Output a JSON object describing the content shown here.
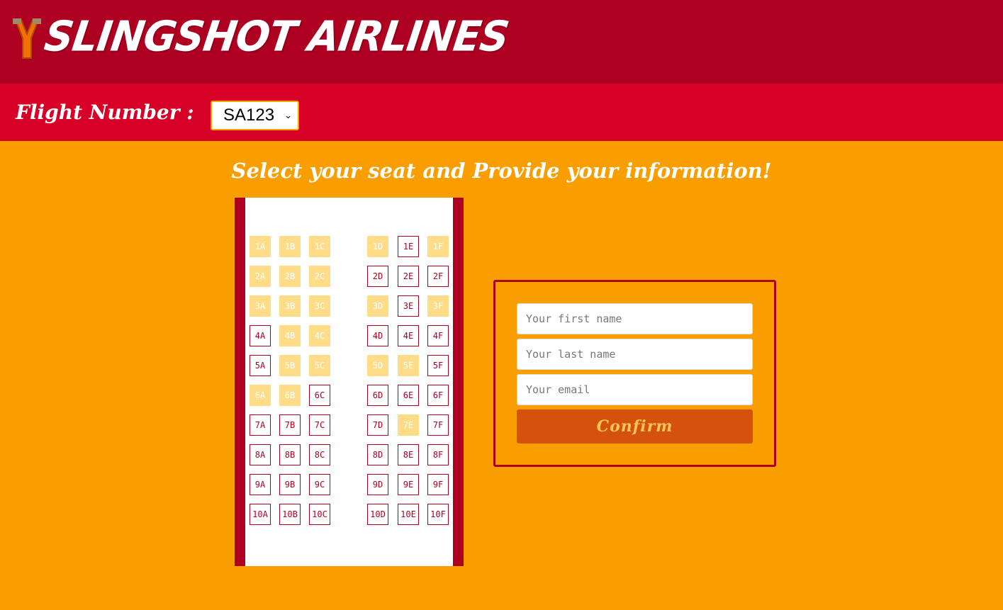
{
  "header": {
    "brand": "SLINGSHOT AIRLINES",
    "logo_icon": "slingshot-icon"
  },
  "flight": {
    "label": "Flight Number :",
    "selected": "SA123"
  },
  "heading": "Select your seat and Provide your information!",
  "seats": {
    "rows": [
      "1",
      "2",
      "3",
      "4",
      "5",
      "6",
      "7",
      "8",
      "9",
      "10"
    ],
    "cols": [
      "A",
      "B",
      "C",
      "D",
      "E",
      "F"
    ],
    "taken": [
      "1A",
      "1B",
      "1C",
      "1D",
      "1F",
      "2A",
      "2B",
      "2C",
      "3A",
      "3B",
      "3C",
      "3D",
      "3F",
      "4B",
      "4C",
      "5B",
      "5C",
      "5D",
      "5E",
      "6A",
      "6B",
      "7E"
    ]
  },
  "form": {
    "first_name_placeholder": "Your first name",
    "last_name_placeholder": "Your last name",
    "email_placeholder": "Your email",
    "confirm_label": "Confirm"
  },
  "colors": {
    "header": "#ae0020",
    "flight_bar": "#d70026",
    "background": "#f89e00",
    "taken_seat": "#ffdd88",
    "confirm": "#d4520e"
  }
}
